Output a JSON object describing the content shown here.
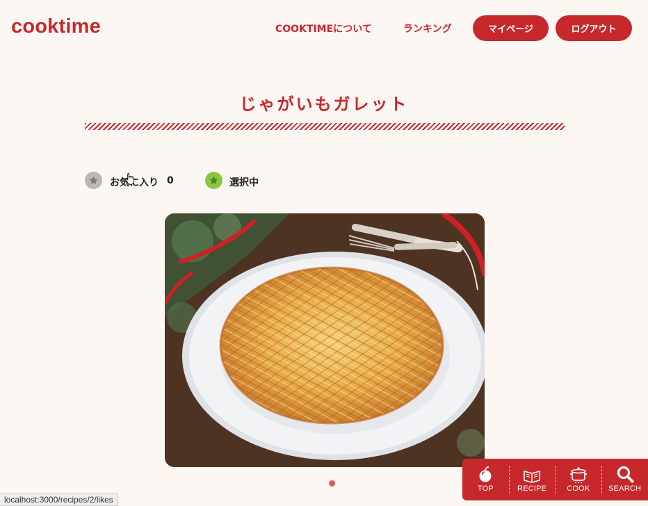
{
  "header": {
    "logo": "cooktime",
    "nav_about": "COOKTIMEについて",
    "nav_ranking": "ランキング",
    "mypage_label": "マイページ",
    "logout_label": "ログアウト"
  },
  "recipe": {
    "title": "じゃがいもガレット",
    "favorite_label": "お気に入り",
    "favorite_count": "0",
    "selected_label": "選択中",
    "image_alt": "じゃがいもガレット"
  },
  "bottom_nav": {
    "items": [
      {
        "label": "TOP",
        "icon": "apple-icon"
      },
      {
        "label": "RECIPE",
        "icon": "book-icon"
      },
      {
        "label": "COOK",
        "icon": "pot-icon"
      },
      {
        "label": "SEARCH",
        "icon": "search-icon"
      }
    ]
  },
  "status_bar": {
    "url": "localhost:3000/recipes/2/likes"
  },
  "colors": {
    "brand": "#c7282b",
    "background": "#fdf7f4",
    "favorite_inactive": "#b9b9b9",
    "selected_active": "#8cc63f"
  }
}
